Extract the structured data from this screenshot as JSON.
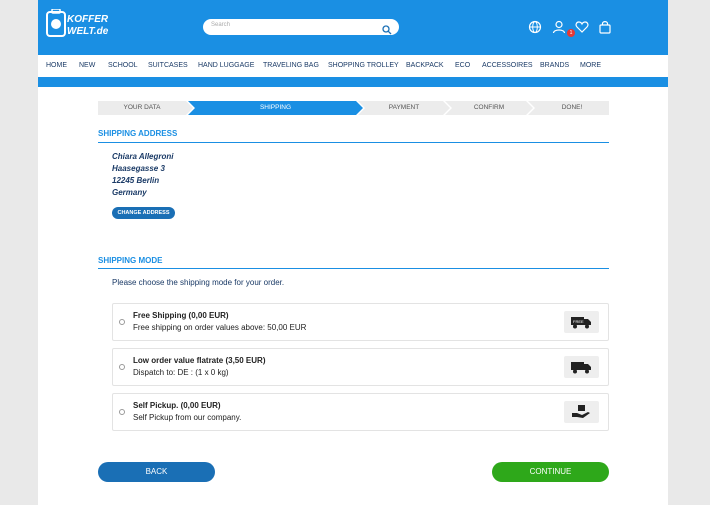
{
  "brand": {
    "logo_line1": "KOFFER",
    "logo_line2": "WELT.de"
  },
  "search": {
    "placeholder": "Search"
  },
  "cart": {
    "count": "1"
  },
  "nav": {
    "items": [
      "HOME",
      "NEW",
      "SCHOOL",
      "SUITCASES",
      "HAND LUGGAGE",
      "TRAVELING BAG",
      "SHOPPING TROLLEY",
      "BACKPACK",
      "ECO",
      "ACCESSOIRES",
      "BRANDS",
      "MORE"
    ]
  },
  "steps": {
    "items": [
      "YOUR DATA",
      "SHIPPING",
      "PAYMENT",
      "CONFIRM",
      "DONE!"
    ],
    "active": "SHIPPING"
  },
  "shipping_address": {
    "title": "SHIPPING ADDRESS",
    "lines": [
      "Chiara Allegroni",
      "Haasegasse 3",
      "12245 Berlin",
      "Germany"
    ],
    "change_label": "CHANGE ADDRESS"
  },
  "shipping_mode": {
    "title": "SHIPPING MODE",
    "intro": "Please choose the shipping mode for your order.",
    "options": [
      {
        "title": "Free Shipping (0,00 EUR)",
        "desc": "Free shipping on order values above: 50,00 EUR",
        "icon": "free-truck-icon"
      },
      {
        "title": "Low order value flatrate (3,50 EUR)",
        "desc": "Dispatch to: DE : (1 x 0 kg)",
        "icon": "truck-icon"
      },
      {
        "title": "Self Pickup. (0,00 EUR)",
        "desc": "Self Pickup from our company.",
        "icon": "hand-box-icon"
      }
    ]
  },
  "actions": {
    "back_label": "BACK",
    "continue_label": "CONTINUE"
  },
  "colors": {
    "brand_blue": "#1a8fe3",
    "button_blue": "#1a6fb5",
    "continue_green": "#2ea81a",
    "step_active": "#1a8fe3",
    "step_inactive": "#ececec"
  }
}
